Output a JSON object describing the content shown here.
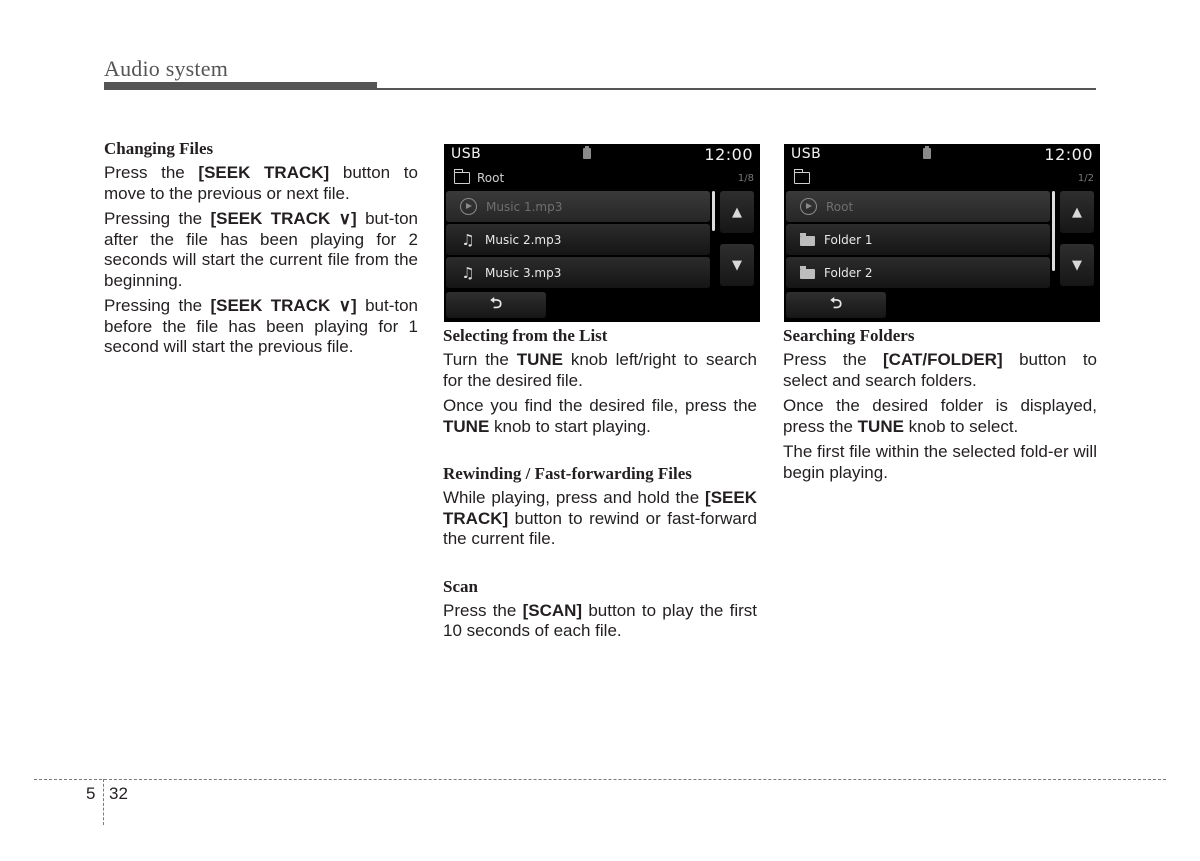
{
  "header": {
    "title": "Audio system"
  },
  "column1": {
    "heading": "Changing Files",
    "paragraphs": [
      {
        "pre": "Press the ",
        "bold": "[SEEK TRACK]",
        "post": " button to move to the previous or next file."
      },
      {
        "pre": "Pressing the ",
        "bold": "[SEEK TRACK ∨]",
        "post": " but-ton after the file has been playing for 2 seconds will start the current file from the beginning."
      },
      {
        "pre": "Pressing the ",
        "bold": "[SEEK TRACK ∨]",
        "post": " but-ton before the file has been playing for 1 second will start the previous file."
      }
    ]
  },
  "screen1": {
    "source": "USB",
    "clock": "12:00",
    "path": "Root",
    "count": "1/8",
    "items": [
      {
        "label": "Music 1.mp3",
        "icon": "play-circle-icon",
        "active": true
      },
      {
        "label": "Music 2.mp3",
        "icon": "music-note-icon",
        "active": false
      },
      {
        "label": "Music 3.mp3",
        "icon": "music-note-icon",
        "active": false
      }
    ],
    "up": "▲",
    "down": "▼",
    "back": "⮌"
  },
  "screen2": {
    "source": "USB",
    "clock": "12:00",
    "path": "",
    "count": "1/2",
    "items": [
      {
        "label": "Root",
        "icon": "play-circle-icon",
        "active": true
      },
      {
        "label": "Folder 1",
        "icon": "folder-icon",
        "active": false
      },
      {
        "label": "Folder 2",
        "icon": "folder-icon",
        "active": false
      }
    ],
    "up": "▲",
    "down": "▼",
    "back": "⮌"
  },
  "column2": {
    "sections": [
      {
        "heading": "Selecting from the List",
        "paragraphs": [
          {
            "pre": "Turn the ",
            "bold": "TUNE",
            "post": " knob left/right to search for the desired file."
          },
          {
            "pre": "Once you find the desired file, press the ",
            "bold": "TUNE",
            "post": " knob to start playing."
          }
        ]
      },
      {
        "heading": "Rewinding / Fast-forwarding Files",
        "paragraphs": [
          {
            "pre": "While playing, press and hold the ",
            "bold": "[SEEK TRACK]",
            "post": " button to rewind or fast-forward the current file."
          }
        ]
      },
      {
        "heading": "Scan",
        "paragraphs": [
          {
            "pre": "Press the ",
            "bold": "[SCAN]",
            "post": " button to play the first 10 seconds of each file."
          }
        ]
      }
    ]
  },
  "column3": {
    "heading": "Searching Folders",
    "paragraphs": [
      {
        "pre": "Press the ",
        "bold": "[CAT/FOLDER]",
        "post": " button to select and search folders."
      },
      {
        "pre": "Once the desired folder is displayed, press the ",
        "bold": "TUNE",
        "post": " knob to select."
      },
      {
        "pre": "The first file within the selected fold-er will begin playing.",
        "bold": "",
        "post": ""
      }
    ]
  },
  "footer": {
    "chapter": "5",
    "page": "32"
  }
}
